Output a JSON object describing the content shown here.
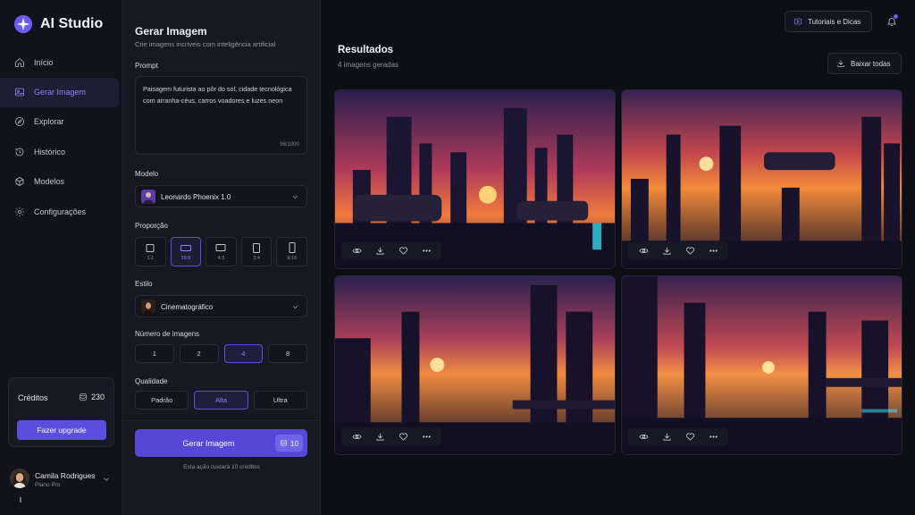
{
  "app": {
    "name": "AI Studio"
  },
  "nav": {
    "items": [
      {
        "label": "Início",
        "icon": "home-icon"
      },
      {
        "label": "Gerar Imagem",
        "icon": "image-icon",
        "active": true
      },
      {
        "label": "Explorar",
        "icon": "compass-icon"
      },
      {
        "label": "Histórico",
        "icon": "history-icon"
      },
      {
        "label": "Modelos",
        "icon": "cube-icon"
      },
      {
        "label": "Configurações",
        "icon": "gear-icon"
      }
    ]
  },
  "credits": {
    "title": "Créditos",
    "count": "230",
    "upgrade_label": "Fazer upgrade"
  },
  "user": {
    "name": "Camila Rodrigues",
    "plan": "Plano Pro"
  },
  "panel": {
    "title": "Gerar Imagem",
    "subtitle": "Crie imagens incríveis com inteligência artificial",
    "prompt_label": "Prompt",
    "prompt_text": "Paisagem futurista ao pôr do sol, cidade tecnológica com arranha-céus, carros voadores e luzes neon",
    "prompt_count": "98/1000",
    "model_label": "Modelo",
    "model_value": "Leonardo Phoenix 1.0",
    "ratio_label": "Proporção",
    "ratios": [
      "1:1",
      "16:9",
      "4:3",
      "3:4",
      "9:16"
    ],
    "ratio_selected": "16:9",
    "style_label": "Estilo",
    "style_value": "Cinematográfico",
    "count_label": "Número de imagens",
    "counts": [
      "1",
      "2",
      "4",
      "8"
    ],
    "count_selected": "4",
    "quality_label": "Qualidade",
    "qualities": [
      "Padrão",
      "Alta",
      "Ultra"
    ],
    "quality_selected": "Alta",
    "generate_label": "Gerar Imagem",
    "generate_cost": "10",
    "generate_note": "Esta ação custará 10 créditos"
  },
  "main": {
    "tutorials_label": "Tutoriais e Dicas",
    "results_title": "Resultados",
    "results_sub": "4 imagens geradas",
    "download_all_label": "Baixar todas",
    "images": [
      {
        "alt": "futuristic city sunset 1"
      },
      {
        "alt": "futuristic city sunset 2"
      },
      {
        "alt": "futuristic city sunset 3"
      },
      {
        "alt": "futuristic city sunset 4"
      }
    ]
  },
  "colors": {
    "accent": "#5b4fe0",
    "accent_text": "#8b84ff",
    "bg": "#0d0e16",
    "panel": "#171822"
  }
}
